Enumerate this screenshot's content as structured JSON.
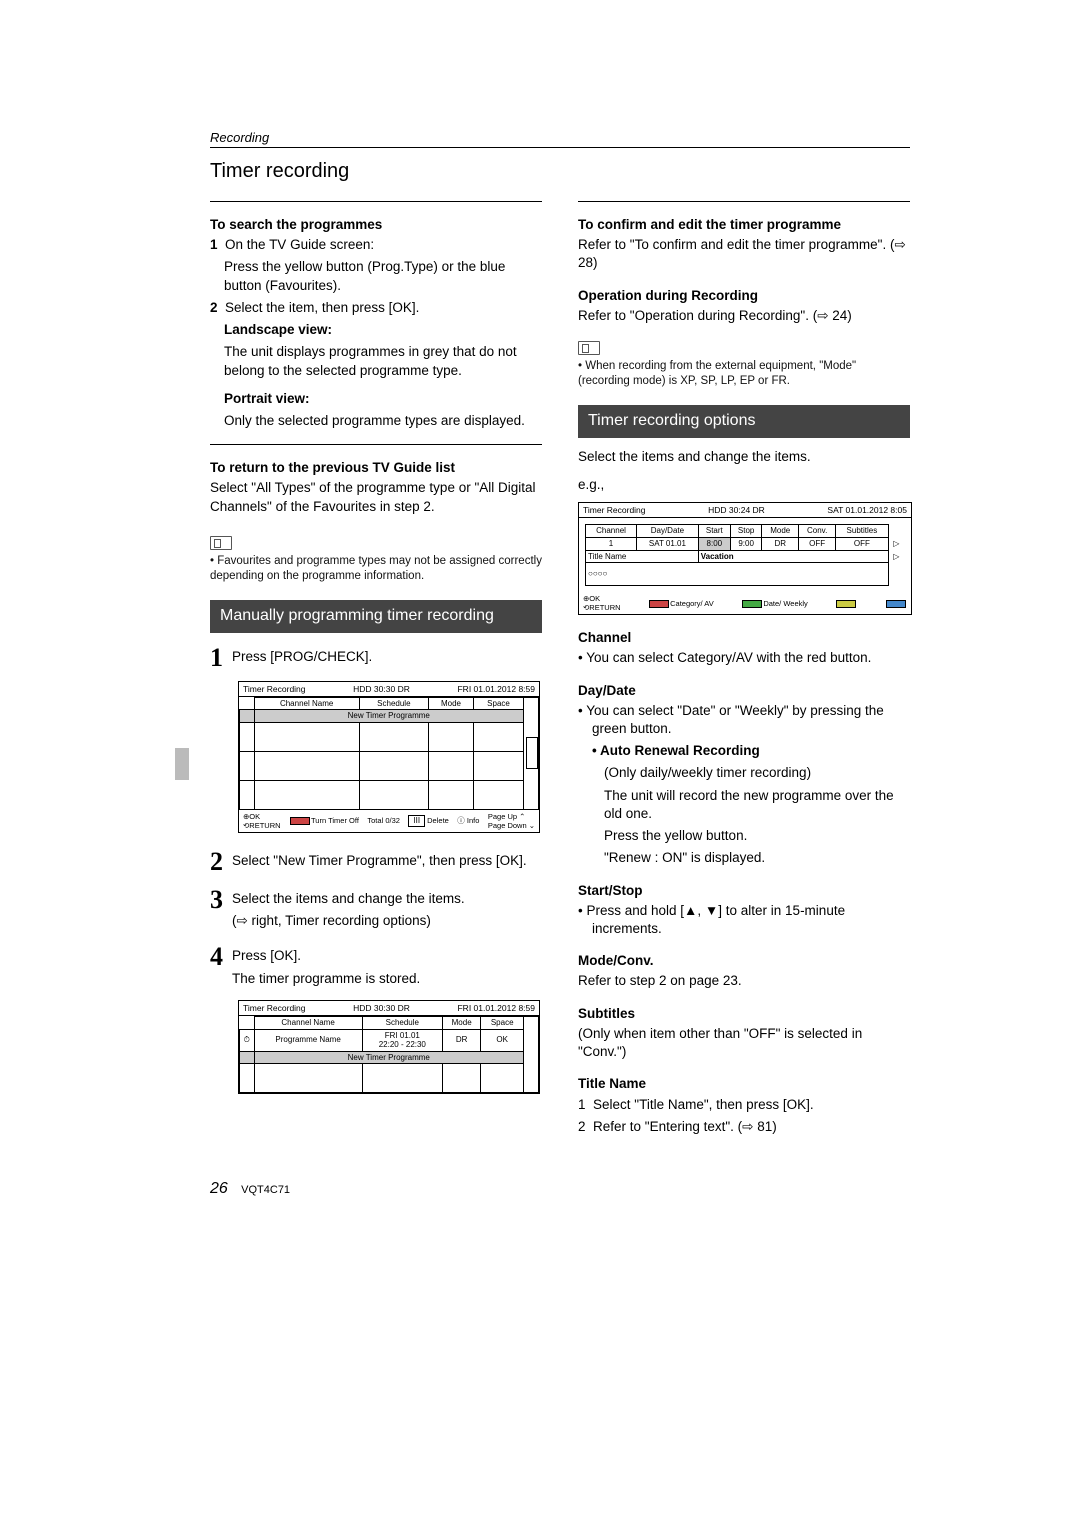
{
  "section_label": "Recording",
  "page_title": "Timer recording",
  "left": {
    "h_search": "To search the programmes",
    "s1_num": "1",
    "s1_a": "On the TV Guide screen:",
    "s1_b": "Press the yellow button (Prog.Type) or the blue button (Favourites).",
    "s2_num": "2",
    "s2_a": "Select the item, then press [OK].",
    "landscape_h": "Landscape view:",
    "landscape_t": "The unit displays programmes in grey that do not belong to the selected programme type.",
    "portrait_h": "Portrait view:",
    "portrait_t": "Only the selected programme types are displayed.",
    "h_return": "To return to the previous TV Guide list",
    "return_t": "Select \"All Types\" of the programme type or \"All Digital Channels\" of the Favourites in step 2.",
    "note1": "Favourites and programme types may not be assigned correctly depending on the programme information.",
    "darkbar1": "Manually programming timer recording",
    "step1_num": "1",
    "step1": "Press [PROG/CHECK].",
    "osd1": {
      "title": "Timer Recording",
      "hdd": "HDD 30:30 DR",
      "date": "FRI 01.01.2012 8:59",
      "cols": [
        "Channel Name",
        "Schedule",
        "Mode",
        "Space"
      ],
      "new_row": "New Timer Programme",
      "total": "Total 0/32",
      "del": "Delete",
      "info": "Info",
      "pgup": "Page Up",
      "pgdn": "Page Down",
      "ok": "OK",
      "ret": "RETURN",
      "turn": "Turn Timer Off"
    },
    "step2_num": "2",
    "step2": "Select \"New Timer Programme\", then press [OK].",
    "step3_num": "3",
    "step3a": "Select the items and change the items.",
    "step3b": "(⇨ right, Timer recording options)",
    "step4_num": "4",
    "step4a": "Press [OK].",
    "step4b": "The timer programme is stored.",
    "osd2": {
      "title": "Timer Recording",
      "hdd": "HDD 30:30 DR",
      "date": "FRI 01.01.2012 8:59",
      "cols": [
        "Channel Name",
        "Schedule",
        "Mode",
        "Space"
      ],
      "row_ch": "Programme Name",
      "row_sched1": "FRI  01.01",
      "row_sched2": "22:20 - 22:30",
      "row_mode": "DR",
      "row_space": "OK",
      "new_row": "New Timer Programme",
      "clock": "⏱"
    }
  },
  "right": {
    "h_confirm": "To confirm and edit the timer programme",
    "confirm_t": "Refer to \"To confirm and edit the timer programme\". (⇨ 28)",
    "h_op": "Operation during Recording",
    "op_t": "Refer to \"Operation during Recording\". (⇨ 24)",
    "note2": "When recording from the external equipment, \"Mode\" (recording mode) is XP, SP, LP, EP or FR.",
    "darkbar2": "Timer recording options",
    "intro": "Select the items and change the items.",
    "eg": "e.g.,",
    "osd3": {
      "title": "Timer Recording",
      "hdd": "HDD 30:24 DR",
      "date": "SAT 01.01.2012 8:05",
      "cols": [
        "Channel",
        "Day/Date",
        "Start",
        "Stop",
        "Mode",
        "Conv.",
        "Subtitles"
      ],
      "vals": [
        "1",
        "SAT 01.01",
        "8:00",
        "9:00",
        "DR",
        "OFF",
        "OFF"
      ],
      "titlename": "Title Name",
      "title_val": "Vacation",
      "ok": "OK",
      "ret": "RETURN",
      "cat": "Category/ AV",
      "dateweek": "Date/ Weekly"
    },
    "h_channel": "Channel",
    "channel_t": "You can select Category/AV with the red button.",
    "h_daydate": "Day/Date",
    "daydate_t": "You can select \"Date\" or \"Weekly\" by pressing the green button.",
    "h_auto": "• Auto Renewal Recording",
    "auto_a": "(Only daily/weekly timer recording)",
    "auto_b": "The unit will record the new programme over the old one.",
    "auto_c": "Press the yellow button.",
    "auto_d": "\"Renew : ON\" is displayed.",
    "h_startstop": "Start/Stop",
    "startstop_t": "Press and hold [▲, ▼] to alter in 15-minute increments.",
    "h_modeconv": "Mode/Conv.",
    "modeconv_t": "Refer to step 2 on page 23.",
    "h_subs": "Subtitles",
    "subs_t": "(Only when item other than \"OFF\" is selected in \"Conv.\")",
    "h_titlename": "Title Name",
    "tn_1": "Select \"Title Name\", then press [OK].",
    "tn_2": "Refer to \"Entering text\". (⇨ 81)"
  },
  "footer": {
    "page": "26",
    "code": "VQT4C71"
  }
}
